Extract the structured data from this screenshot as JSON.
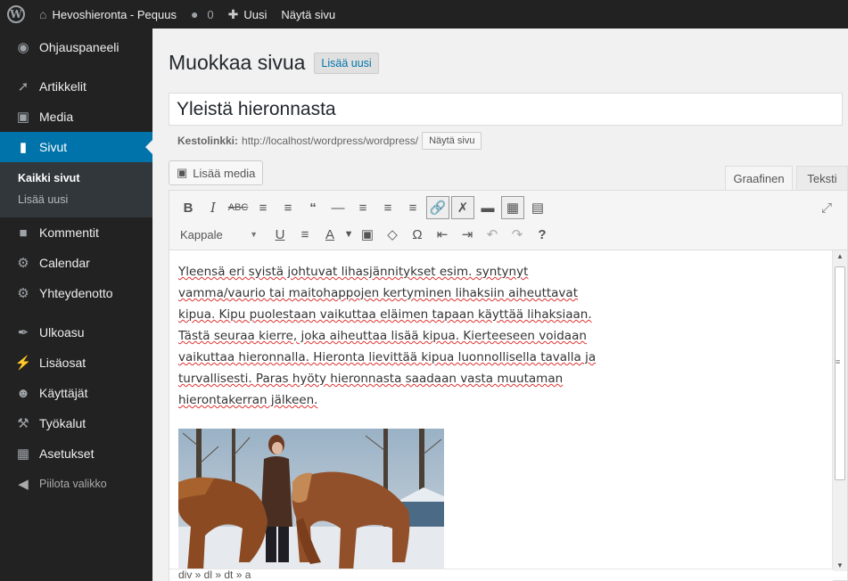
{
  "adminbar": {
    "site_name": "Hevoshieronta - Pequus",
    "comments_count": "0",
    "new_label": "Uusi",
    "view_page_label": "Näytä sivu"
  },
  "sidebar": {
    "items": [
      {
        "label": "Ohjauspaneeli",
        "icon": "dashboard-icon"
      },
      {
        "label": "Artikkelit",
        "icon": "pushpin-icon"
      },
      {
        "label": "Media",
        "icon": "media-icon"
      },
      {
        "label": "Sivut",
        "icon": "pages-icon"
      },
      {
        "label": "Kommentit",
        "icon": "comment-icon"
      },
      {
        "label": "Calendar",
        "icon": "gear-icon"
      },
      {
        "label": "Yhteydenotto",
        "icon": "gear-icon"
      },
      {
        "label": "Ulkoasu",
        "icon": "brush-icon"
      },
      {
        "label": "Lisäosat",
        "icon": "plugin-icon"
      },
      {
        "label": "Käyttäjät",
        "icon": "users-icon"
      },
      {
        "label": "Työkalut",
        "icon": "wrench-icon"
      },
      {
        "label": "Asetukset",
        "icon": "settings-icon"
      }
    ],
    "submenu": [
      "Kaikki sivut",
      "Lisää uusi"
    ],
    "collapse_label": "Piilota valikko"
  },
  "main": {
    "page_title": "Muokkaa sivua",
    "add_new_label": "Lisää uusi",
    "post_title": "Yleistä hieronnasta",
    "permalink_label": "Kestolinkki:",
    "permalink_url": "http://localhost/wordpress/wordpress/",
    "view_page_button": "Näytä sivu",
    "add_media_label": "Lisää media",
    "tab_visual": "Graafinen",
    "tab_text": "Teksti",
    "format_select": "Kappale",
    "content_text": "Yleensä eri syistä johtuvat lihasjännitykset esim. syntynyt vamma/vaurio tai maitohappojen kertyminen lihaksiin aiheuttavat kipua. Kipu puolestaan vaikuttaa eläimen tapaan käyttää lihaksiaan. Tästä seuraa kierre, joka aiheuttaa lisää kipua. Kierteeseen voidaan vaikuttaa hieronnalla. Hieronta lievittää kipua luonnollisella tavalla ja turvallisesti. Paras hyöty hieronnasta saadaan vasta muutaman hierontakerran jälkeen.",
    "path_bar": "div » dl » dt » a"
  },
  "colors": {
    "adminbar_bg": "#222222",
    "sidebar_bg": "#222222",
    "accent": "#0073aa",
    "submenu_bg": "#32373c"
  }
}
